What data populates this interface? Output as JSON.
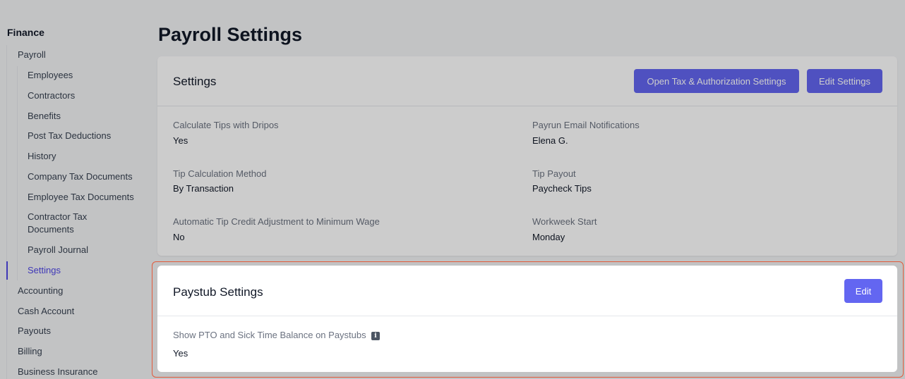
{
  "sidebar": {
    "section": "Finance",
    "payroll": "Payroll",
    "payroll_items": [
      "Employees",
      "Contractors",
      "Benefits",
      "Post Tax Deductions",
      "History",
      "Company Tax Documents",
      "Employee Tax Documents",
      "Contractor Tax Documents",
      "Payroll Journal",
      "Settings"
    ],
    "other_items": [
      "Accounting",
      "Cash Account",
      "Payouts",
      "Billing",
      "Business Insurance"
    ]
  },
  "page": {
    "title": "Payroll Settings"
  },
  "settings_card": {
    "title": "Settings",
    "tax_button": "Open Tax & Authorization Settings",
    "edit_button": "Edit Settings",
    "fields": {
      "calc_tips_label": "Calculate Tips with Dripos",
      "calc_tips_value": "Yes",
      "email_notif_label": "Payrun Email Notifications",
      "email_notif_value": "Elena G.",
      "tip_method_label": "Tip Calculation Method",
      "tip_method_value": "By Transaction",
      "tip_payout_label": "Tip Payout",
      "tip_payout_value": "Paycheck Tips",
      "tip_credit_label": "Automatic Tip Credit Adjustment to Minimum Wage",
      "tip_credit_value": "No",
      "workweek_label": "Workweek Start",
      "workweek_value": "Monday"
    }
  },
  "paystub_card": {
    "title": "Paystub Settings",
    "edit_button": "Edit",
    "pto_label": "Show PTO and Sick Time Balance on Paystubs",
    "pto_value": "Yes",
    "info_glyph": "i"
  }
}
